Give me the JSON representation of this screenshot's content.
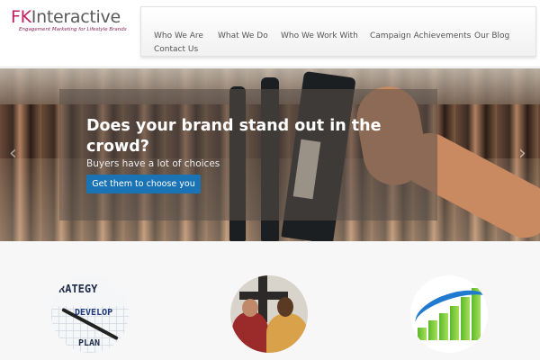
{
  "brand": {
    "logo_prefix": "FK",
    "logo_suffix": "Interactive",
    "tagline": "Engagement Marketing for Lifestyle Brands"
  },
  "nav": {
    "items": [
      "Who We Are",
      "What We Do",
      "Who We Work With",
      "Campaign Achievements",
      "Our Blog",
      "Contact Us"
    ]
  },
  "hero": {
    "title": "Does your brand stand out in the crowd?",
    "subtitle": "Buyers have a lot of choices",
    "cta_label": "Get them to choose you",
    "prev_arrow": "‹",
    "next_arrow": "›"
  },
  "features": {
    "strategy_image_text": [
      "RATEGY",
      "DEVELOP",
      "PLAN"
    ]
  },
  "colors": {
    "brand_pink": "#c0215e",
    "cta_blue": "#1a73b5",
    "nav_text": "#555555"
  }
}
